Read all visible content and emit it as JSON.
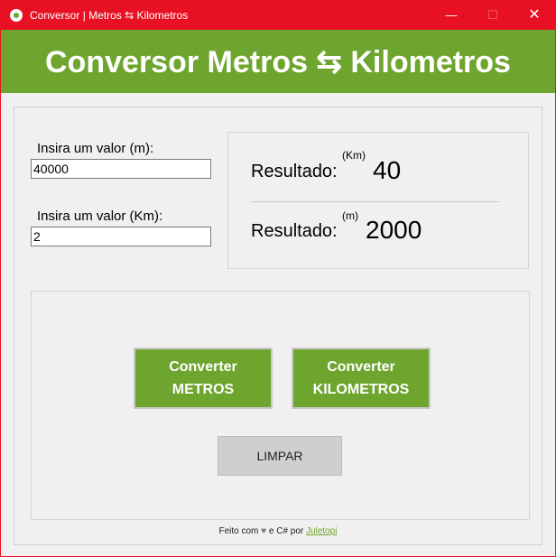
{
  "window": {
    "title": "Conversor | Metros ⇆ Kilometros",
    "minimize_glyph": "—",
    "maximize_glyph": "☐",
    "close_glyph": "✕",
    "accent_color": "#e81123"
  },
  "header": {
    "title": "Conversor Metros ⇆ Kilometros",
    "background_color": "#6ea52f"
  },
  "inputs": {
    "meters": {
      "label": "Insira um valor (m):",
      "value": "40000"
    },
    "kilometers": {
      "label": "Insira um valor (Km):",
      "value": "2"
    }
  },
  "results": {
    "km": {
      "label": "Resultado:",
      "unit": "(Km)",
      "value": "40"
    },
    "m": {
      "label": "Resultado:",
      "unit": "(m)",
      "value": "2000"
    }
  },
  "buttons": {
    "convert_meters": {
      "line1": "Converter",
      "line2": "METROS"
    },
    "convert_kilometers": {
      "line1": "Converter",
      "line2": "KILOMETROS"
    },
    "clear": "LIMPAR"
  },
  "footer": {
    "prefix": "Feito com",
    "heart_icon": "heart-icon",
    "middle": "e C# por",
    "author": "Juletopi"
  }
}
